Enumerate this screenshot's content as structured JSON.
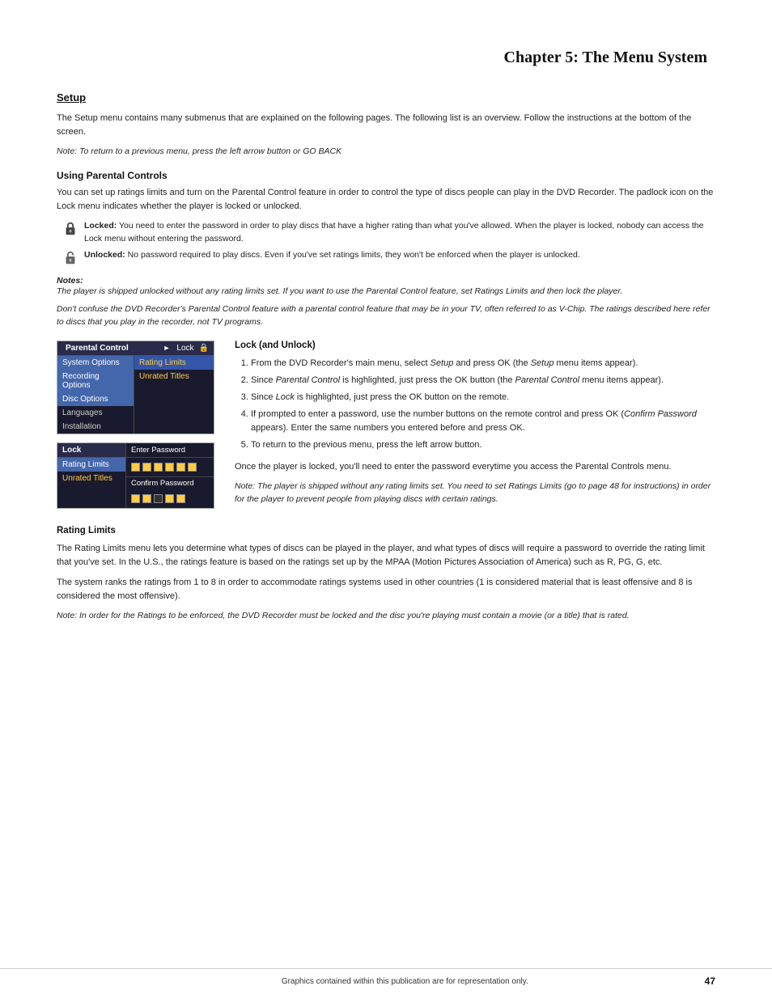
{
  "page": {
    "chapter_heading": "Chapter 5: The Menu System",
    "section_setup": "Setup",
    "setup_intro": "The Setup menu contains many submenus that are explained on the following pages. The following list is an overview. Follow the instructions at the bottom of the screen.",
    "setup_note": "Note: To return to a previous menu, press the left arrow button or GO BACK",
    "subsection_parental": "Using Parental Controls",
    "parental_intro": "You can set up ratings limits and turn on the Parental Control feature in order to control the type of discs people can play in the DVD Recorder. The padlock icon on the Lock menu indicates whether the player is locked or unlocked.",
    "locked_label": "Locked:",
    "locked_text": " You need to enter the password in order to play discs that have a higher rating than what you've allowed. When the player is locked, nobody can access the Lock menu without entering the password.",
    "unlocked_label": "Unlocked:",
    "unlocked_text": " No password required to play discs. Even if you've set ratings limits, they won't be enforced when the player is unlocked.",
    "notes_label": "Notes:",
    "note1": "The player is shipped unlocked without any rating limits set. If you want to use the Parental Control feature, set Ratings Limits and then lock the player.",
    "note2": "Don't confuse the DVD Recorder's Parental Control feature with a parental control feature that may be in your TV, often referred to as V-Chip. The ratings described here refer to discs that you play in the recorder, not TV programs.",
    "lock_and_unlock_heading": "Lock (and Unlock)",
    "steps": [
      "From the DVD Recorder's main menu, select Setup and press OK (the Setup menu items appear).",
      "Since Parental Control is highlighted, just press the OK button (the Parental Control menu items appear).",
      "Since Lock is highlighted, just press the OK button on the remote.",
      "If prompted to enter a password, use the number buttons on the remote control and press OK (Confirm Password appears). Enter the same numbers you entered before and press OK.",
      "To return to the previous menu, press the left arrow button."
    ],
    "after_lock_text": "Once the player is locked, you'll need to enter the password everytime you access the Parental Controls menu.",
    "after_lock_note": "Note: The player is shipped without any rating limits set. You need to set Ratings Limits (go to page 48 for instructions) in order for the player to prevent people from playing discs with certain ratings.",
    "rating_limits_heading": "Rating Limits",
    "rating_limits_text1": "The Rating Limits menu lets you determine what types of discs can be played in the player, and what types of discs will require a password to override the rating limit that you've set. In the U.S., the ratings feature is based on the ratings set up by the MPAA (Motion Pictures Association of America) such as R, PG, G, etc.",
    "rating_limits_text2": "The system ranks the ratings from 1 to 8 in order to accommodate ratings systems used in other countries (1 is considered material that is least offensive and 8 is considered the most offensive).",
    "rating_limits_note": "Note: In order for the Ratings to be enforced, the DVD Recorder must be locked and the disc you're playing must contain a movie (or a title) that is rated.",
    "footer_center": "Graphics contained within this publication are for representation only.",
    "footer_page": "47",
    "menu1": {
      "title": "Parental Control",
      "items": [
        {
          "label": "System Options",
          "highlighted": false
        },
        {
          "label": "Recording Options",
          "highlighted": false
        },
        {
          "label": "Disc Options",
          "highlighted": false
        },
        {
          "label": "Languages",
          "highlighted": false
        },
        {
          "label": "Installation",
          "highlighted": false
        }
      ],
      "submenu_title": "Lock",
      "submenu_items": [
        {
          "label": "Rating Limits",
          "highlighted": true
        },
        {
          "label": "Unrated Titles",
          "highlighted": false
        }
      ]
    },
    "menu2": {
      "left_title": "Lock",
      "left_items": [
        {
          "label": "Rating Limits",
          "highlighted": false
        },
        {
          "label": "Unrated Titles",
          "highlighted": false
        }
      ],
      "right_title": "Enter Password",
      "right_label2": "Confirm Password"
    }
  }
}
